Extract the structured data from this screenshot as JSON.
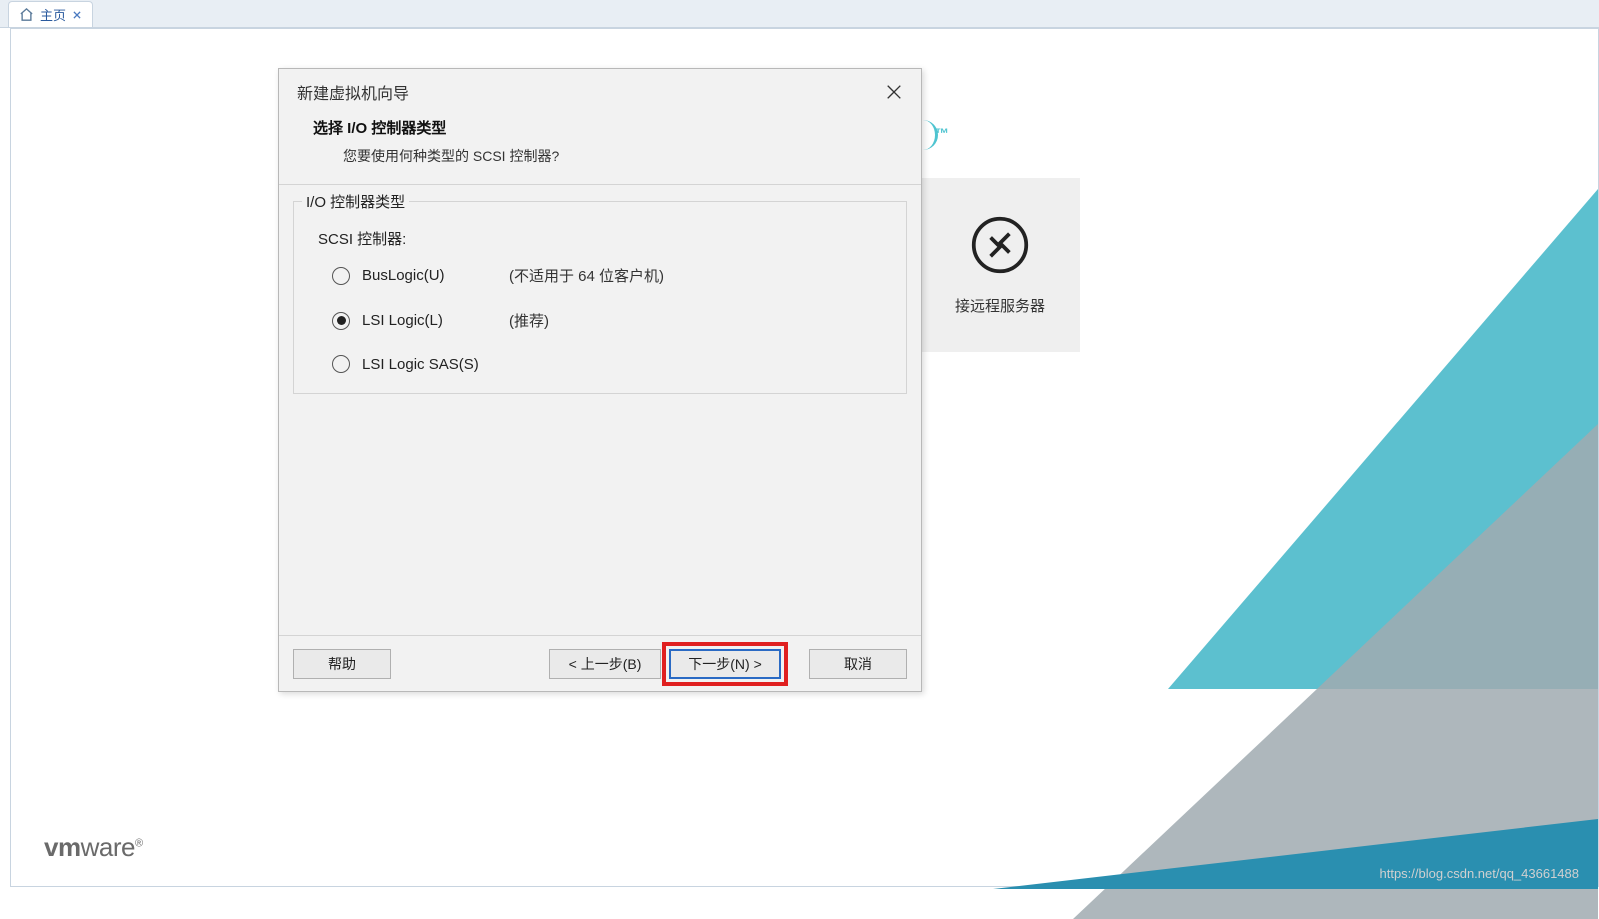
{
  "tab": {
    "label": "主页"
  },
  "tm": "™",
  "card": {
    "label": "接远程服务器"
  },
  "logo": {
    "vm": "vm",
    "ware": "ware",
    "reg": "®"
  },
  "watermark": "https://blog.csdn.net/qq_43661488",
  "dialog": {
    "title": "新建虚拟机向导",
    "heading": "选择 I/O 控制器类型",
    "subheading": "您要使用何种类型的 SCSI 控制器?",
    "fieldset_legend": "I/O 控制器类型",
    "scsi_label": "SCSI 控制器:",
    "options": [
      {
        "label": "BusLogic(U)",
        "hint": "(不适用于 64 位客户机)",
        "selected": false
      },
      {
        "label": "LSI Logic(L)",
        "hint": "(推荐)",
        "selected": true
      },
      {
        "label": "LSI Logic SAS(S)",
        "hint": "",
        "selected": false
      }
    ],
    "buttons": {
      "help": "帮助",
      "back": "< 上一步(B)",
      "next": "下一步(N) >",
      "cancel": "取消"
    }
  }
}
